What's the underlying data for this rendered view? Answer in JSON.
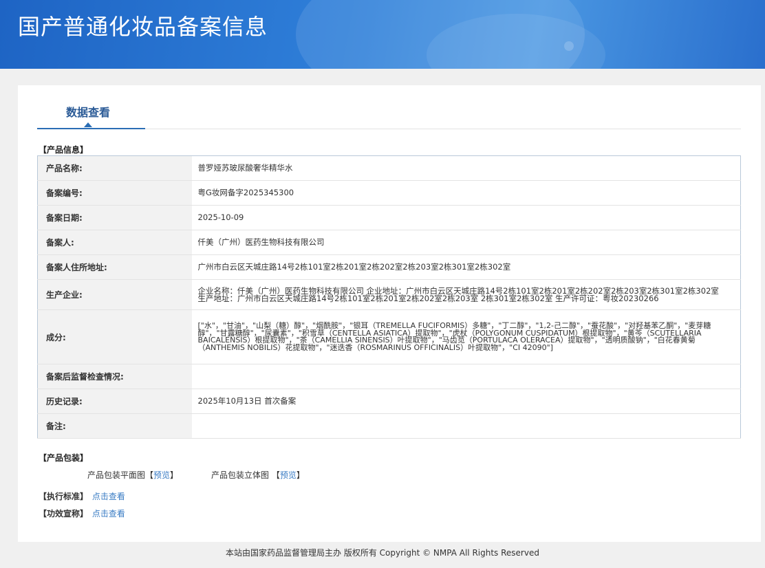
{
  "header": {
    "title": "国产普通化妆品备案信息"
  },
  "tabs": [
    {
      "label": "数据查看"
    }
  ],
  "product_info": {
    "section_title": "【产品信息】",
    "rows": [
      {
        "key": "产品名称:",
        "value": "普罗娅苏玻尿酸奢华精华水"
      },
      {
        "key": "备案编号:",
        "value": "粤G妆网备字2025345300"
      },
      {
        "key": "备案日期:",
        "value": "2025-10-09"
      },
      {
        "key": "备案人:",
        "value": "仟美（广州）医药生物科技有限公司"
      },
      {
        "key": "备案人住所地址:",
        "value": "广州市白云区天城庄路14号2栋101室2栋201室2栋202室2栋203室2栋301室2栋302室"
      },
      {
        "key": "生产企业:",
        "value": "企业名称：仟美（广州）医药生物科技有限公司 企业地址：广州市白云区天城庄路14号2栋101室2栋201室2栋202室2栋203室2栋301室2栋302室 生产地址：广州市白云区天城庄路14号2栋101室2栋201室2栋202室2栋203室 2栋301室2栋302室 生产许可证：粤妆20230266"
      },
      {
        "key": "成分:",
        "value": "[\"水\"，\"甘油\"，\"山梨（糖）醇\"，\"烟酰胺\"，\"银耳（TREMELLA FUCIFORMIS）多糖\"，\"丁二醇\"，\"1,2-己二醇\"，\"蚕花酸\"，\"对羟基苯乙酮\"，\"麦芽糖醇\"，\"甘露糖醇\"，\"尿囊素\"，\"积雪草（CENTELLA ASIATICA）提取物\"，\"虎杖（POLYGONUM CUSPIDATUM）根提取物\"，\"黄芩（SCUTELLARIA BAICALENSIS）根提取物\"，\"茶（CAMELLIA SINENSIS）叶提取物\"，\"马齿苋（PORTULACA OLERACEA）提取物\"，\"透明质酸钠\"，\"白花春黄菊（ANTHEMIS NOBILIS）花提取物\"，\"迷迭香（ROSMARINUS OFFICINALIS）叶提取物\"，\"CI 42090\"]"
      },
      {
        "key": "备案后监督检查情况:",
        "value": ""
      },
      {
        "key": "历史记录:",
        "value": "2025年10月13日 首次备案"
      },
      {
        "key": "备注:",
        "value": ""
      }
    ]
  },
  "packaging": {
    "section_title": "【产品包装】",
    "flat_label": "产品包装平面图【",
    "solid_label": "产品包装立体图 【",
    "preview_link": "预览",
    "close_bracket": "】"
  },
  "standard": {
    "section_title": "【执行标准】",
    "link": "点击查看"
  },
  "efficacy": {
    "section_title": "【功效宣称】",
    "link": "点击查看"
  },
  "footer": {
    "text": "本站由国家药品监督管理局主办 版权所有 Copyright © NMPA All Rights Reserved"
  }
}
